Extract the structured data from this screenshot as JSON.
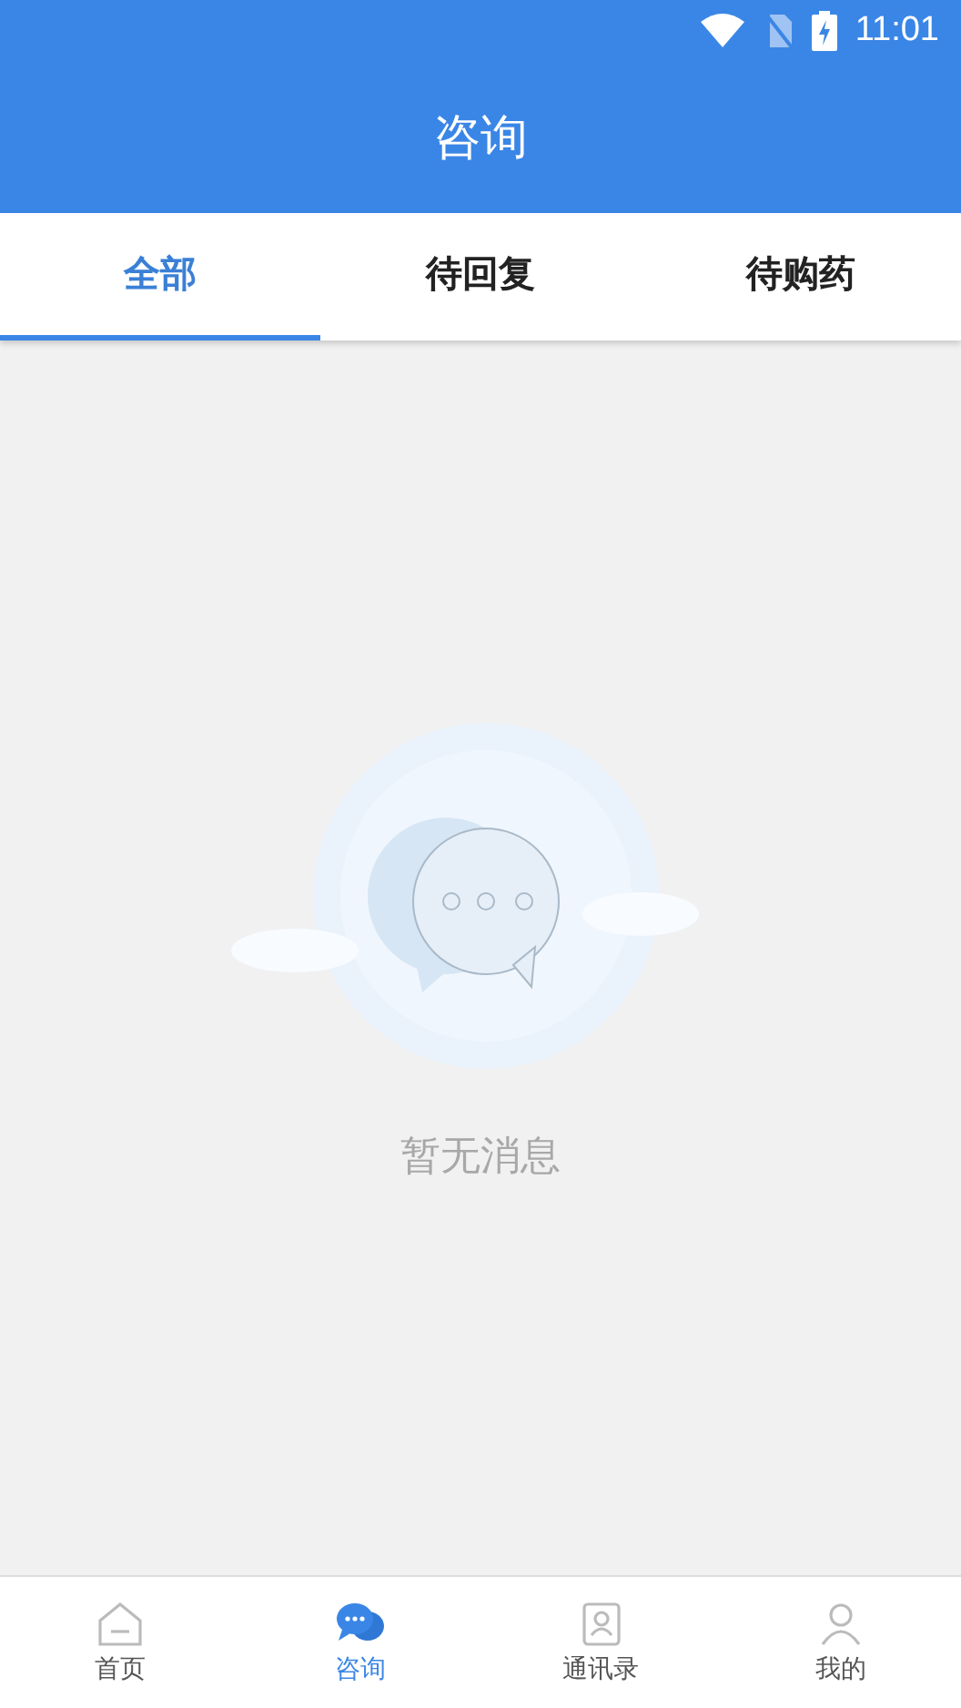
{
  "status_bar": {
    "time": "11:01"
  },
  "header": {
    "title": "咨询"
  },
  "tabs": [
    {
      "label": "全部",
      "selected": true
    },
    {
      "label": "待回复",
      "selected": false
    },
    {
      "label": "待购药",
      "selected": false
    }
  ],
  "empty_state": {
    "message": "暂无消息"
  },
  "bottom_nav": [
    {
      "label": "首页",
      "kind": "home",
      "selected": false
    },
    {
      "label": "咨询",
      "kind": "chat",
      "selected": true
    },
    {
      "label": "通讯录",
      "kind": "contacts",
      "selected": false
    },
    {
      "label": "我的",
      "kind": "profile",
      "selected": false
    }
  ]
}
